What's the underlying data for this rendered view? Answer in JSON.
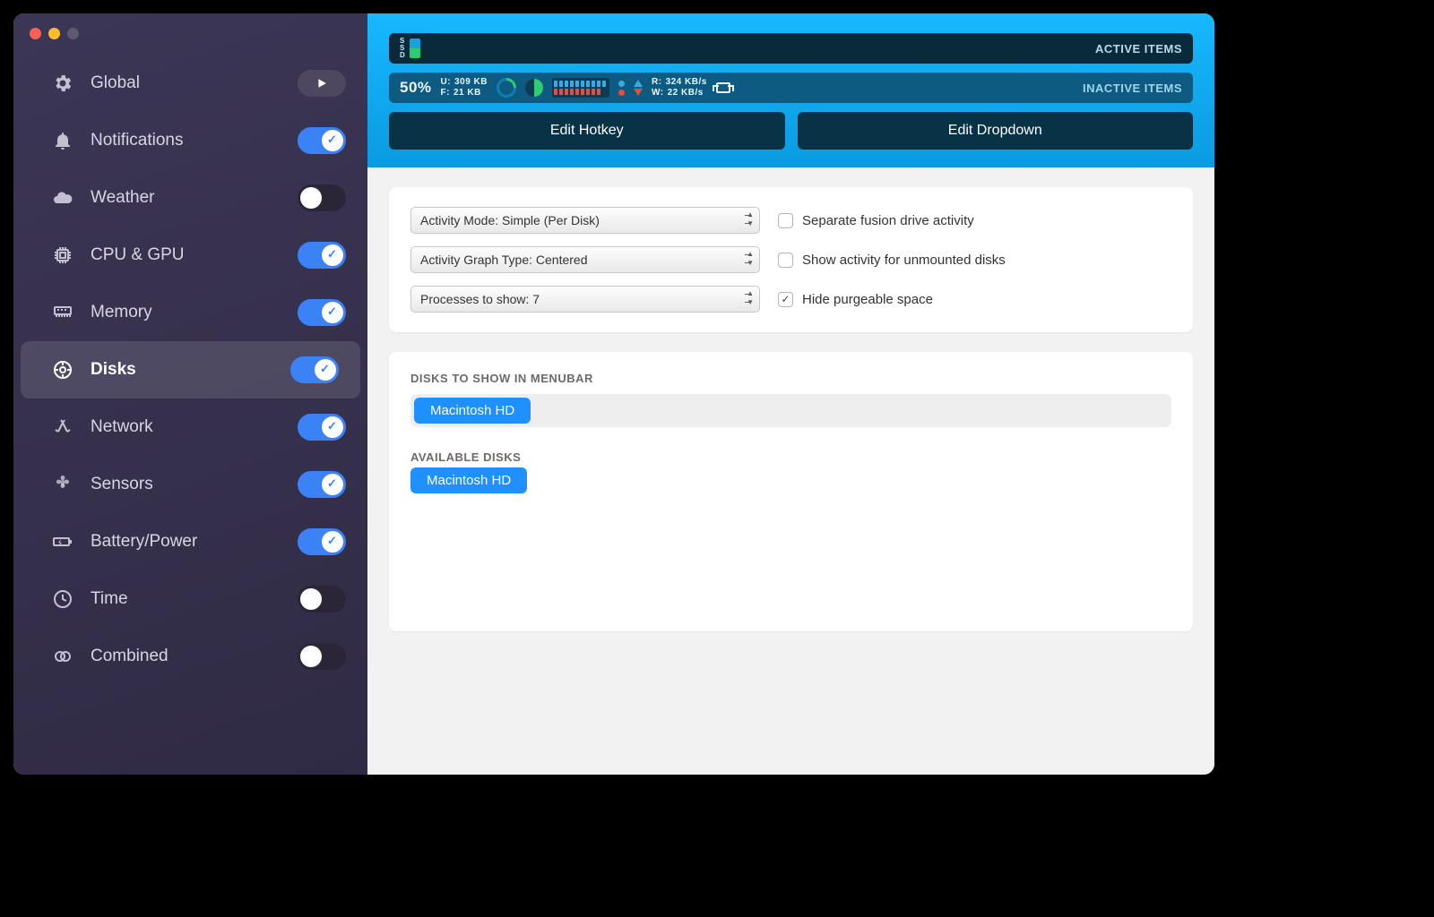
{
  "sidebar": {
    "items": [
      {
        "label": "Global",
        "icon": "gear",
        "control": "play"
      },
      {
        "label": "Notifications",
        "icon": "bell",
        "on": true
      },
      {
        "label": "Weather",
        "icon": "cloud",
        "on": false
      },
      {
        "label": "CPU & GPU",
        "icon": "chip",
        "on": true
      },
      {
        "label": "Memory",
        "icon": "memory",
        "on": true
      },
      {
        "label": "Disks",
        "icon": "disc",
        "on": true,
        "active": true
      },
      {
        "label": "Network",
        "icon": "arrows",
        "on": true
      },
      {
        "label": "Sensors",
        "icon": "fan",
        "on": true
      },
      {
        "label": "Battery/Power",
        "icon": "battery",
        "on": true
      },
      {
        "label": "Time",
        "icon": "clock",
        "on": false
      },
      {
        "label": "Combined",
        "icon": "rings",
        "on": false
      }
    ]
  },
  "hero": {
    "active_label": "ACTIVE ITEMS",
    "inactive_label": "INACTIVE ITEMS",
    "ssd_label": "SSD",
    "pct": "50%",
    "uf": {
      "u_label": "U:",
      "u_val": "309 KB",
      "f_label": "F:",
      "f_val": "21 KB"
    },
    "rw": {
      "r_label": "R:",
      "r_val": "324 KB/s",
      "w_label": "W:",
      "w_val": "22 KB/s"
    },
    "edit_hotkey": "Edit Hotkey",
    "edit_dropdown": "Edit Dropdown"
  },
  "settings": {
    "activity_mode": "Activity Mode: Simple (Per Disk)",
    "graph_type": "Activity Graph Type: Centered",
    "processes": "Processes to show: 7",
    "separate_fusion": "Separate fusion drive activity",
    "show_unmounted": "Show activity for unmounted disks",
    "hide_purgeable": "Hide purgeable space",
    "hide_purgeable_checked": true
  },
  "disks": {
    "menubar_title": "DISKS TO SHOW IN MENUBAR",
    "available_title": "AVAILABLE DISKS",
    "menubar": [
      "Macintosh HD"
    ],
    "available": [
      "Macintosh HD"
    ]
  }
}
